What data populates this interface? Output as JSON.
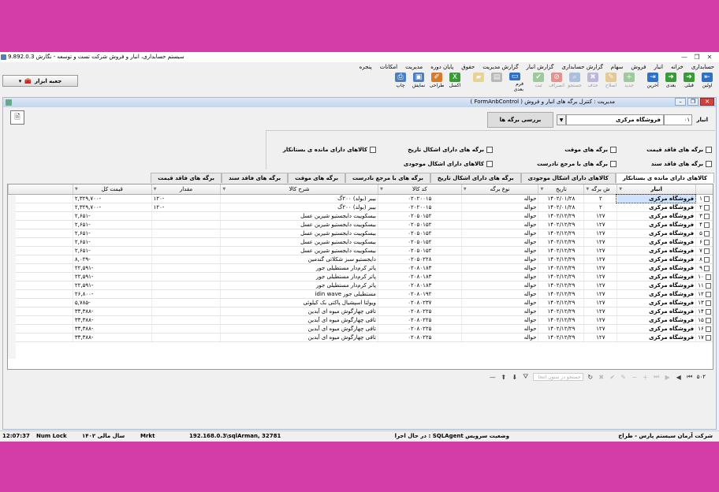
{
  "window": {
    "title": "سیستم حسابداری، انبار و فروش شرکت تست و توسعه - نگارش 9.892.0.3",
    "buttons": [
      "✕",
      "❐",
      "—"
    ]
  },
  "menu": [
    "حسابداری",
    "خزانه",
    "انبار",
    "فروش",
    "سهام",
    "گزارش حسابداری",
    "گزارش انبار",
    "گزارش مدیریت",
    "حقوق",
    "پایان دوره",
    "مدیریت",
    "امکانات",
    "پنجره"
  ],
  "toolbar": [
    {
      "label": "اولین",
      "icon": "first-icon",
      "color": "#2f6fc4",
      "glyph": "⇤",
      "enabled": true
    },
    {
      "label": "قبلی",
      "icon": "prev-icon",
      "color": "#3a9a3a",
      "glyph": "➜",
      "enabled": true
    },
    {
      "label": "بعدی",
      "icon": "next-icon",
      "color": "#3a9a3a",
      "glyph": "➜",
      "enabled": true
    },
    {
      "label": "آخرین",
      "icon": "last-icon",
      "color": "#2f6fc4",
      "glyph": "⇥",
      "enabled": true
    },
    {
      "label": "جدید",
      "icon": "add-icon",
      "color": "#3a9a3a",
      "glyph": "+",
      "enabled": false
    },
    {
      "label": "اصلاح",
      "icon": "edit-icon",
      "color": "#d79a2b",
      "glyph": "✎",
      "enabled": false
    },
    {
      "label": "حذف",
      "icon": "delete-icon",
      "color": "#8070c0",
      "glyph": "✖",
      "enabled": false
    },
    {
      "label": "جستجو",
      "icon": "search-icon",
      "color": "#5b87c9",
      "glyph": "⌕",
      "enabled": false
    },
    {
      "label": "انصراف",
      "icon": "cancel-icon",
      "color": "#d42020",
      "glyph": "⦸",
      "enabled": false
    },
    {
      "label": "ثبت",
      "icon": "save-icon",
      "color": "#3a9a3a",
      "glyph": "✔",
      "enabled": false
    },
    {
      "label": "فرم بعدی",
      "icon": "next-form-icon",
      "color": "#2f6fc4",
      "glyph": "▭",
      "enabled": true
    },
    {
      "label": "",
      "icon": "print-setup-icon",
      "color": "#777777",
      "glyph": "▤",
      "enabled": false
    },
    {
      "label": "",
      "icon": "folder-icon",
      "color": "#e0b020",
      "glyph": "▰",
      "enabled": false
    },
    {
      "label": "اکسل",
      "icon": "excel-icon",
      "color": "#3a9a3a",
      "glyph": "X",
      "enabled": true
    },
    {
      "label": "طراحی",
      "icon": "design-icon",
      "color": "#d77a2b",
      "glyph": "✐",
      "enabled": true
    },
    {
      "label": "نمایش",
      "icon": "preview-icon",
      "color": "#4a7fc0",
      "glyph": "▣",
      "enabled": true
    },
    {
      "label": "چاپ",
      "icon": "print-icon",
      "color": "#4a7fc0",
      "glyph": "⎙",
      "enabled": true
    }
  ],
  "toolbox": {
    "label": "جعبه ابزار"
  },
  "child": {
    "title": "مدیریت : کنترل برگه های انبار و فروش ( FormAnbControl )",
    "store_label": "انبار",
    "store_code": "۰۱",
    "store_name": "فروشگاه مرکزی",
    "review_button": "بررسی برگه ها"
  },
  "filters": [
    "برگه های فاقد قیمت",
    "برگه های موقت",
    "برگه های دارای اشکال تاریخ",
    "کالاهای دارای مانده ی بستانکار",
    "برگه های فاقد سند",
    "برگه های با مرجع نادرست",
    "کالاهای دارای اشکال موجودی"
  ],
  "tabs": [
    "کالاهای دارای مانده ی بستانکار",
    "کالاهای دارای اشکال موجودی",
    "برگه های دارای اشکال تاریخ",
    "برگه های با مرجع نادرست",
    "برگه های موقت",
    "برگه های فاقد سند",
    "برگه های فاقد قیمت"
  ],
  "table": {
    "columns": [
      "انبار",
      "ش برگه",
      "تاریخ",
      "نوع برگه",
      "کد کالا",
      "شرح کالا",
      "مقدار",
      "قیمت کل"
    ],
    "rows": [
      [
        "فروشگاه مرکزی",
        "۲",
        "۱۴۰۲/۰۱/۲۸",
        "حواله",
        "۰۲۰۲۰۰۱۵",
        "بیبر (بولد) ۲۰۰گ",
        "۱۲۰-",
        "۲,۳۲۹,۷۰۰-"
      ],
      [
        "فروشگاه مرکزی",
        "۲",
        "۱۴۰۲/۰۱/۲۸",
        "حواله",
        "۰۲۰۲۰۰۱۵",
        "بیبر (بولد) ۲۰۰گ",
        "۱۲۰-",
        "۲,۳۲۹,۷۰۰-"
      ],
      [
        "فروشگاه مرکزی",
        "۱۲۷",
        "۱۴۰۲/۱۲/۲۹",
        "حواله",
        "۰۲۰۵۰۱۵۲",
        "بیسکوییت دایجستیو شیرین عسل",
        "",
        "۲,۶۵۱-"
      ],
      [
        "فروشگاه مرکزی",
        "۱۲۷",
        "۱۴۰۲/۱۲/۲۹",
        "حواله",
        "۰۲۰۵۰۱۵۲",
        "بیسکوییت دایجستیو شیرین عسل",
        "",
        "۲,۶۵۱-"
      ],
      [
        "فروشگاه مرکزی",
        "۱۲۷",
        "۱۴۰۲/۱۲/۲۹",
        "حواله",
        "۰۲۰۵۰۱۵۲",
        "بیسکوییت دایجستیو شیرین عسل",
        "",
        "۲,۶۵۱-"
      ],
      [
        "فروشگاه مرکزی",
        "۱۲۷",
        "۱۴۰۲/۱۲/۲۹",
        "حواله",
        "۰۲۰۵۰۱۵۲",
        "بیسکوییت دایجستیو شیرین عسل",
        "",
        "۲,۶۵۱-"
      ],
      [
        "فروشگاه مرکزی",
        "۱۲۷",
        "۱۴۰۲/۱۲/۲۹",
        "حواله",
        "۰۲۰۵۰۱۵۲",
        "بیسکوییت دایجستیو شیرین عسل",
        "",
        "۲,۶۵۱-"
      ],
      [
        "فروشگاه مرکزی",
        "۱۲۷",
        "۱۴۰۲/۱۲/۲۹",
        "حواله",
        "۰۲۰۵۰۲۲۸",
        "دایجستیو سبز شکلاتی گندمین",
        "",
        "۸,۰۲۹-"
      ],
      [
        "فروشگاه مرکزی",
        "۱۲۷",
        "۱۴۰۲/۱۲/۲۹",
        "حواله",
        "۰۲۰۸۰۱۸۳",
        "پاتر کرم‌دار مستطیلی جور",
        "",
        "۲۲,۵۹۱-"
      ],
      [
        "فروشگاه مرکزی",
        "۱۲۷",
        "۱۴۰۲/۱۲/۲۹",
        "حواله",
        "۰۲۰۸۰۱۸۳",
        "پاتر کرم‌دار مستطیلی جور",
        "",
        "۲۲,۵۹۱-"
      ],
      [
        "فروشگاه مرکزی",
        "۱۲۷",
        "۱۴۰۲/۱۲/۲۹",
        "حواله",
        "۰۲۰۸۰۱۸۳",
        "پاتر کرم‌دار مستطیلی جور",
        "",
        "۲۲,۵۹۱-"
      ],
      [
        "فروشگاه مرکزی",
        "۱۲۷",
        "۱۴۰۲/۱۲/۲۹",
        "حواله",
        "۰۲۰۸۰۱۹۲",
        "مستطیلی جور idin wave",
        "",
        "۲۶,۸۰۰-"
      ],
      [
        "فروشگاه مرکزی",
        "۱۲۷",
        "۱۴۰۲/۱۲/۲۹",
        "حواله",
        "۰۲۰۸۰۲۳۷",
        "ویولتا اسپشیال پاکتی بک کیلوئی",
        "",
        "۵,۷۸۵-"
      ],
      [
        "فروشگاه مرکزی",
        "۱۲۷",
        "۱۴۰۲/۱۲/۲۹",
        "حواله",
        "۰۲۰۸۰۲۲۵",
        "تافی چهارگوش میوه ای آیدین",
        "",
        "۳۳,۳۸۸-"
      ],
      [
        "فروشگاه مرکزی",
        "۱۲۷",
        "۱۴۰۲/۱۲/۲۹",
        "حواله",
        "۰۲۰۸۰۲۲۵",
        "تافی چهارگوش میوه ای آیدین",
        "",
        "۳۳,۳۸۸-"
      ],
      [
        "فروشگاه مرکزی",
        "۱۲۷",
        "۱۴۰۲/۱۲/۲۹",
        "حواله",
        "۰۲۰۸۰۲۲۵",
        "تافی چهارگوش میوه ای آیدین",
        "",
        "۳۳,۳۸۸-"
      ],
      [
        "فروشگاه مرکزی",
        "۱۲۷",
        "۱۴۰۲/۱۲/۲۹",
        "حواله",
        "۰۲۰۸۰۲۲۵",
        "تافی چهارگوش میوه ای آیدین",
        "",
        "۳۳,۳۸۸-"
      ]
    ]
  },
  "navigator": {
    "count": "۵۰۲",
    "filter_placeholder": "جستجو در ستون انتخا"
  },
  "statusbar": {
    "company": "شرکت آرمان سیستم پارس - طراح",
    "service": "در حال اجرا : SQLAgent وضعیت سرویس",
    "connection": "192.168.0.3\\sqlArman, 32781",
    "mrkt": "Mrkt",
    "fiscal_year": "سال مالی ۱۴۰۲",
    "numlock": "Num Lock",
    "time": "12:07:37"
  }
}
